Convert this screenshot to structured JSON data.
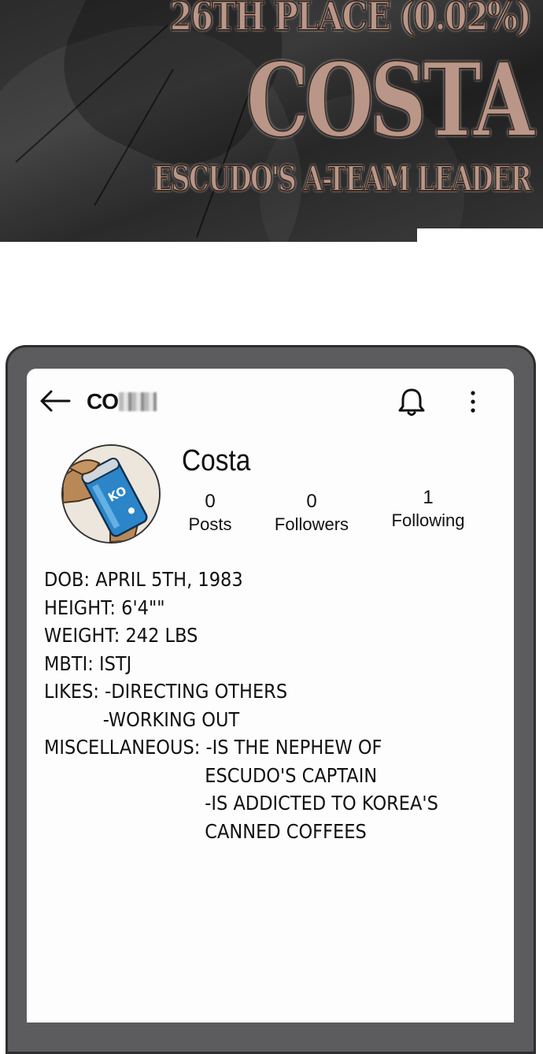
{
  "banner": {
    "rank": "26TH PLACE (0.02%)",
    "name": "COSTA",
    "role": "ESCUDO'S A-TEAM LEADER"
  },
  "profile": {
    "username": "CO",
    "display_name": "Costa",
    "stats": [
      {
        "value": "0",
        "label": "Posts"
      },
      {
        "value": "0",
        "label": "Followers"
      },
      {
        "value": "1",
        "label": "Following"
      }
    ],
    "avatar_icon": "hand-holding-coffee-can",
    "bio": [
      "DOB: APRIL 5TH, 1983",
      "HEIGHT: 6'4\"\"",
      "WEIGHT: 242 LBS",
      "MBTI: ISTJ",
      "LIKES: -DIRECTING OTHERS",
      "-WORKING OUT",
      "MISCELLANEOUS: -IS THE NEPHEW OF",
      "ESCUDO'S CAPTAIN",
      "-IS ADDICTED TO KOREA'S",
      "CANNED COFFEES"
    ]
  },
  "icons": {
    "back": "arrow-left-icon",
    "notifications": "bell-icon",
    "menu": "more-vertical-icon"
  },
  "colors": {
    "banner_text": "#b99688",
    "phone_frame": "#5c5c5e",
    "screen": "#fdfdfd"
  }
}
